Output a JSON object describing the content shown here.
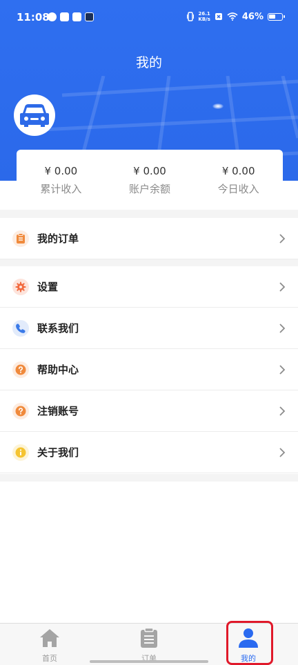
{
  "status_bar": {
    "time": "11:08",
    "speed_top": "26.1",
    "speed_bottom": "KB/s",
    "battery": "46%"
  },
  "header": {
    "title": "我的"
  },
  "stats": [
    {
      "value": "¥ 0.00",
      "label": "累计收入"
    },
    {
      "value": "¥ 0.00",
      "label": "账户余额"
    },
    {
      "value": "¥ 0.00",
      "label": "今日收入"
    }
  ],
  "menu": {
    "orders": {
      "label": "我的订单",
      "icon": "clipboard-icon",
      "color": "#f08a3c"
    },
    "settings": {
      "label": "设置",
      "icon": "gear-icon",
      "color": "#f26a3f"
    },
    "contact": {
      "label": "联系我们",
      "icon": "phone-icon",
      "color": "#3a7ae8"
    },
    "help": {
      "label": "帮助中心",
      "icon": "question-icon",
      "color": "#f08a3c"
    },
    "cancel_account": {
      "label": "注销账号",
      "icon": "question-icon",
      "color": "#f08a3c"
    },
    "about": {
      "label": "关于我们",
      "icon": "info-icon",
      "color": "#f5c431"
    }
  },
  "bottom_nav": {
    "home": "首页",
    "orders": "订单",
    "mine": "我的",
    "active": "mine",
    "active_color": "#2a6af0"
  }
}
